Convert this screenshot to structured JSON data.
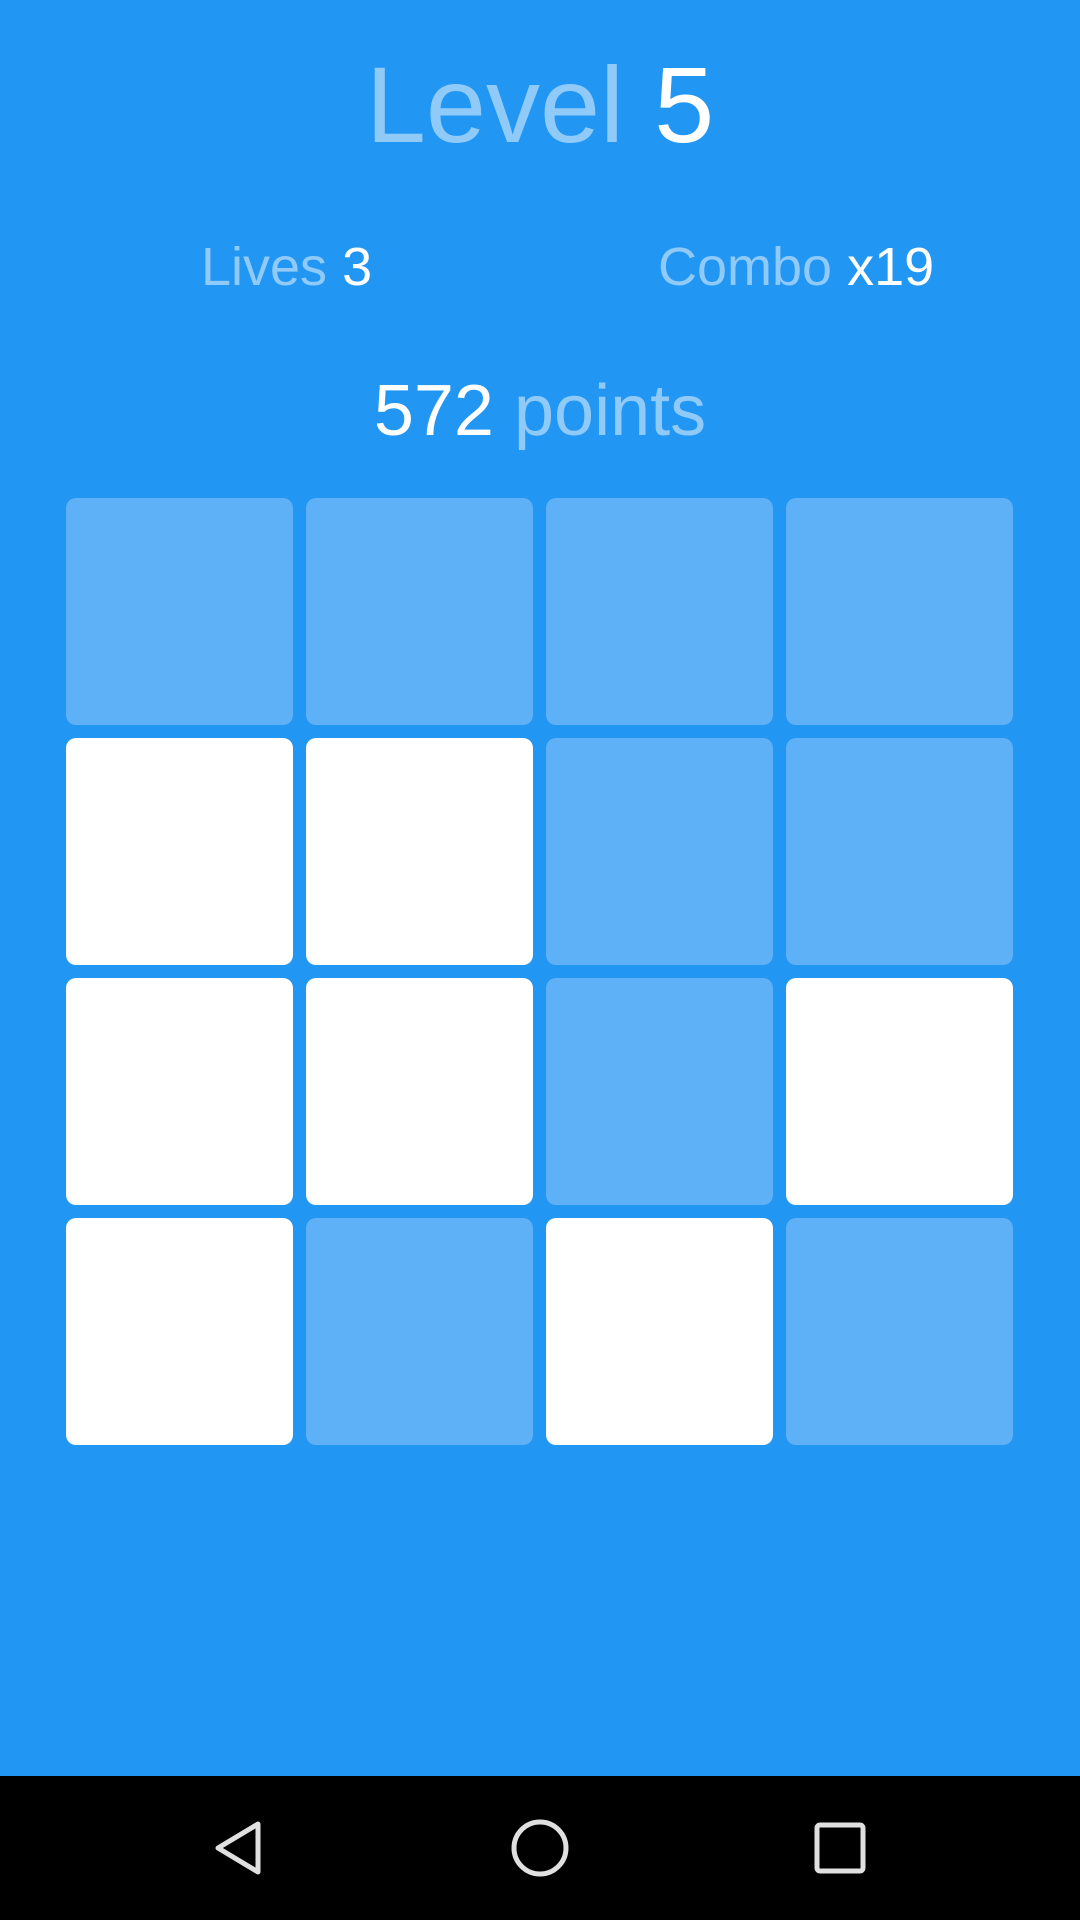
{
  "header": {
    "level_label": "Level",
    "level_value": "5"
  },
  "stats": {
    "lives_label": "Lives",
    "lives_value": "3",
    "combo_label": "Combo",
    "combo_value": "x19"
  },
  "score": {
    "value": "572",
    "unit": "points"
  },
  "board": {
    "rows": 4,
    "cols": 4,
    "tiles": [
      [
        0,
        0,
        0,
        0
      ],
      [
        1,
        1,
        0,
        0
      ],
      [
        1,
        1,
        0,
        1
      ],
      [
        1,
        0,
        1,
        0
      ]
    ],
    "tile_on_color": "#FFFFFF",
    "tile_off_color": "#5EB1F6",
    "background_color": "#2196F3"
  },
  "navigation": {
    "back_icon": "back-triangle-icon",
    "home_icon": "home-circle-icon",
    "recents_icon": "recents-square-icon"
  }
}
